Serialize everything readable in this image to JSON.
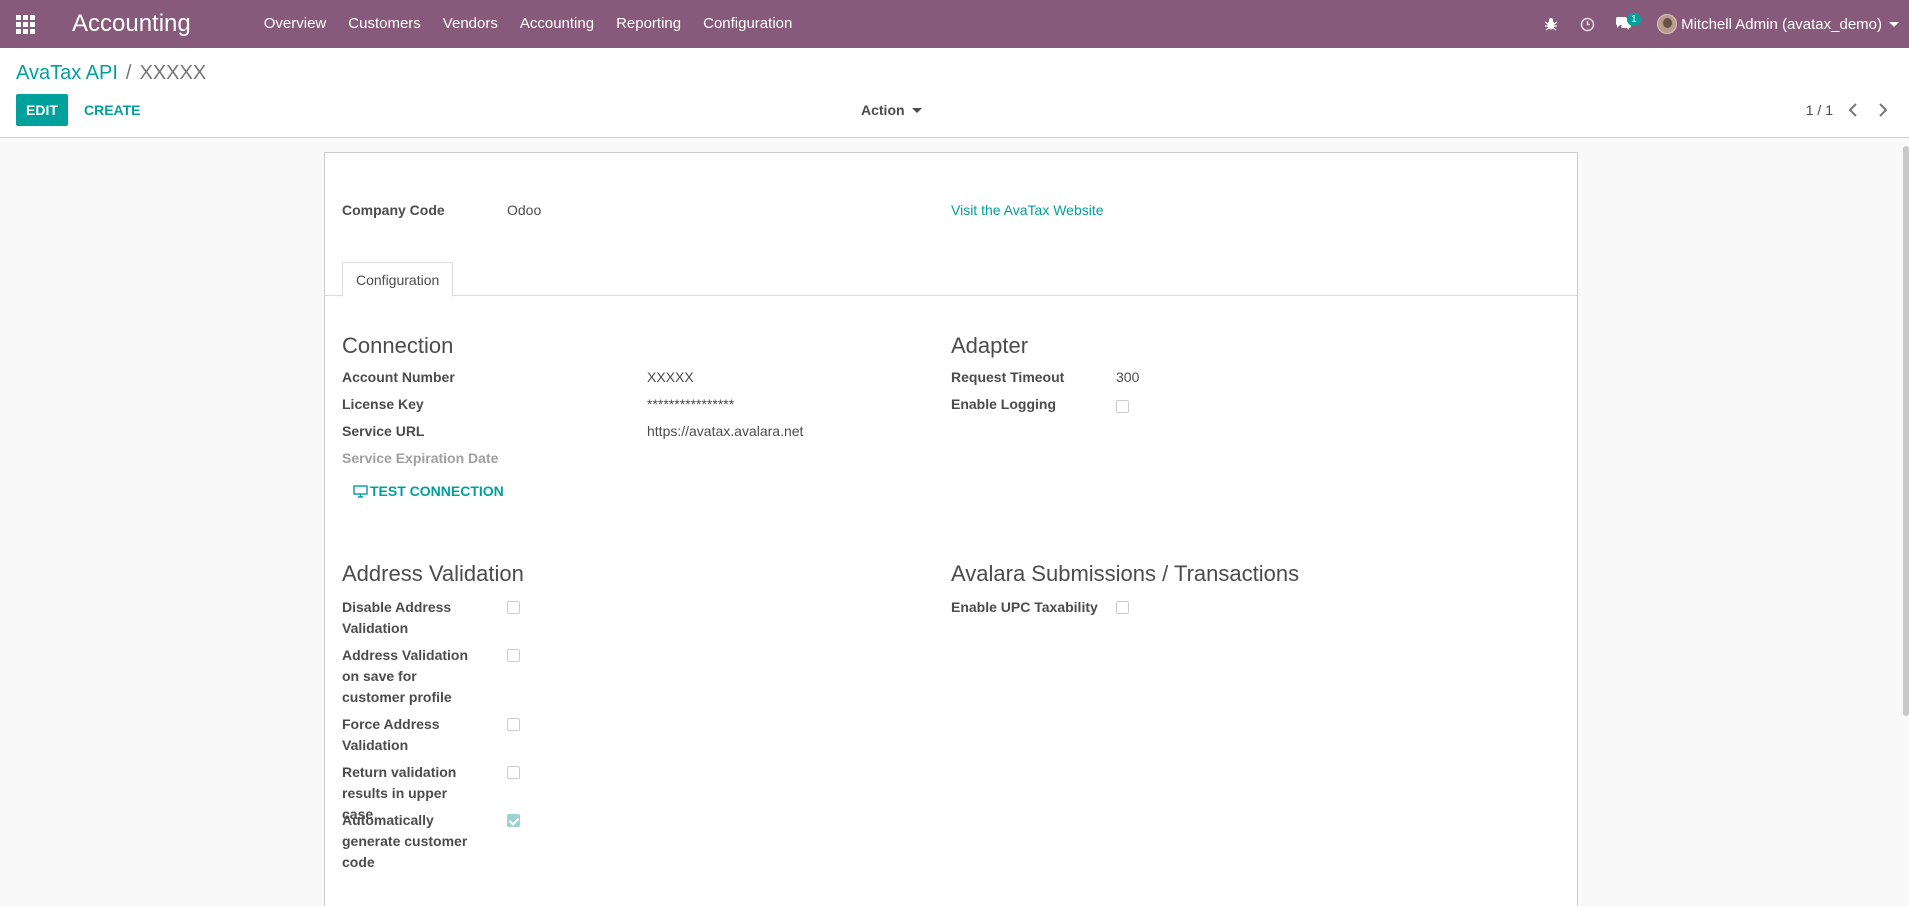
{
  "navbar": {
    "app_title": "Accounting",
    "menu": [
      "Overview",
      "Customers",
      "Vendors",
      "Accounting",
      "Reporting",
      "Configuration"
    ],
    "message_count": "1",
    "user": "Mitchell Admin (avatax_demo)",
    "bg_color": "#875a7b"
  },
  "control": {
    "breadcrumb_parent": "AvaTax API",
    "breadcrumb_sep": "/",
    "breadcrumb_current": "XXXXX",
    "edit_label": "EDIT",
    "create_label": "CREATE",
    "action_label": "Action",
    "pager": "1 / 1"
  },
  "form": {
    "company_code_label": "Company Code",
    "company_code_value": "Odoo",
    "website_link": "Visit the AvaTax Website",
    "tab_label": "Configuration",
    "connection": {
      "title": "Connection",
      "account_number_label": "Account Number",
      "account_number_value": "XXXXX",
      "license_key_label": "License Key",
      "license_key_value": "****************",
      "service_url_label": "Service URL",
      "service_url_value": "https://avatax.avalara.net",
      "expiration_label": "Service Expiration Date",
      "test_button": "TEST CONNECTION"
    },
    "adapter": {
      "title": "Adapter",
      "timeout_label": "Request Timeout",
      "timeout_value": "300",
      "logging_label": "Enable Logging",
      "logging_checked": false
    },
    "address_validation": {
      "title": "Address Validation",
      "items": [
        {
          "label": "Disable Address Validation",
          "checked": false
        },
        {
          "label": "Address Validation on save for customer profile",
          "checked": false
        },
        {
          "label": "Force Address Validation",
          "checked": false
        },
        {
          "label": "Return validation results in upper case",
          "checked": false
        },
        {
          "label": "Automatically generate customer code",
          "checked": true
        }
      ]
    },
    "submissions": {
      "title": "Avalara Submissions / Transactions",
      "upc_label": "Enable UPC Taxability",
      "upc_checked": false
    }
  },
  "colors": {
    "accent": "#00a09d",
    "brand": "#875a7b"
  }
}
